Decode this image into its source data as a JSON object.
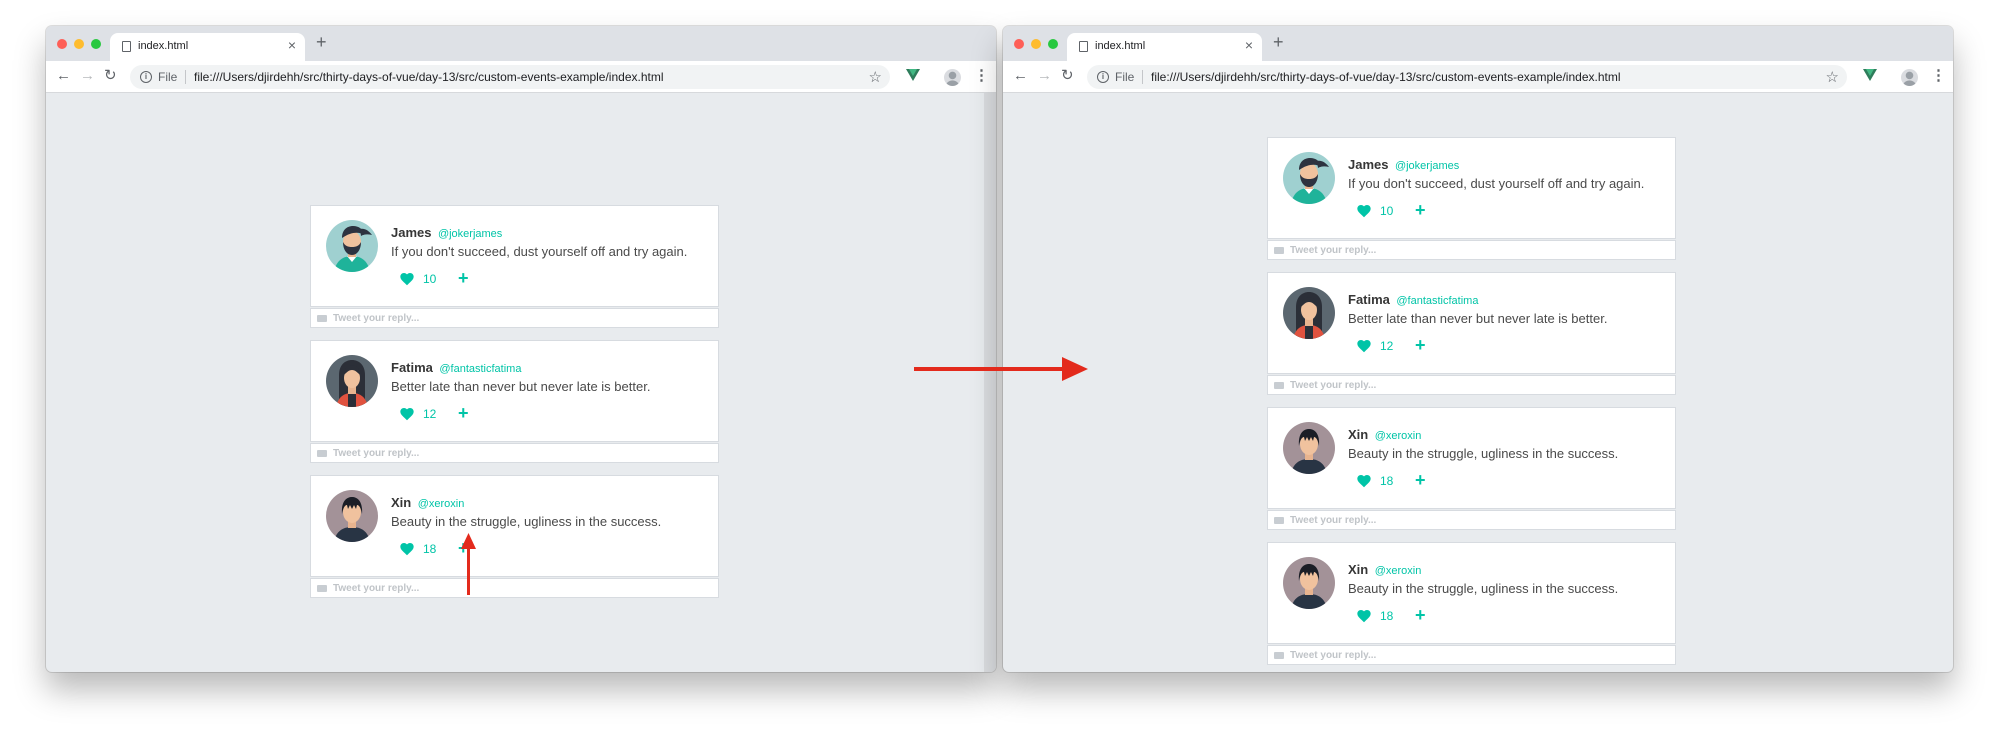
{
  "colors": {
    "accent": "#00c4a7",
    "annotation": "#e32a1c",
    "page_background": "#e8ebee"
  },
  "left": {
    "tab_title": "index.html",
    "address": {
      "scheme_label": "File",
      "url": "file:///Users/djirdehh/src/thirty-days-of-vue/day-13/src/custom-events-example/index.html"
    },
    "tweets": [
      {
        "name": "James",
        "handle": "@jokerjames",
        "text": "If you don't succeed, dust yourself off and try again.",
        "likes": "10",
        "reply_placeholder": "Tweet your reply..."
      },
      {
        "name": "Fatima",
        "handle": "@fantasticfatima",
        "text": "Better late than never but never late is better.",
        "likes": "12",
        "reply_placeholder": "Tweet your reply..."
      },
      {
        "name": "Xin",
        "handle": "@xeroxin",
        "text": "Beauty in the struggle, ugliness in the success.",
        "likes": "18",
        "reply_placeholder": "Tweet your reply..."
      }
    ]
  },
  "right": {
    "tab_title": "index.html",
    "address": {
      "scheme_label": "File",
      "url": "file:///Users/djirdehh/src/thirty-days-of-vue/day-13/src/custom-events-example/index.html"
    },
    "tweets": [
      {
        "name": "James",
        "handle": "@jokerjames",
        "text": "If you don't succeed, dust yourself off and try again.",
        "likes": "10",
        "reply_placeholder": "Tweet your reply..."
      },
      {
        "name": "Fatima",
        "handle": "@fantasticfatima",
        "text": "Better late than never but never late is better.",
        "likes": "12",
        "reply_placeholder": "Tweet your reply..."
      },
      {
        "name": "Xin",
        "handle": "@xeroxin",
        "text": "Beauty in the struggle, ugliness in the success.",
        "likes": "18",
        "reply_placeholder": "Tweet your reply..."
      },
      {
        "name": "Xin",
        "handle": "@xeroxin",
        "text": "Beauty in the struggle, ugliness in the success.",
        "likes": "18",
        "reply_placeholder": "Tweet your reply..."
      }
    ]
  },
  "icons": {
    "add": "+",
    "close": "×",
    "new_tab": "+",
    "back": "←",
    "forward": "→",
    "reload": "↻",
    "star": "☆",
    "menu": "⋮",
    "info": "i"
  },
  "avatars": [
    "james-avatar",
    "fatima-avatar",
    "xin-avatar"
  ]
}
